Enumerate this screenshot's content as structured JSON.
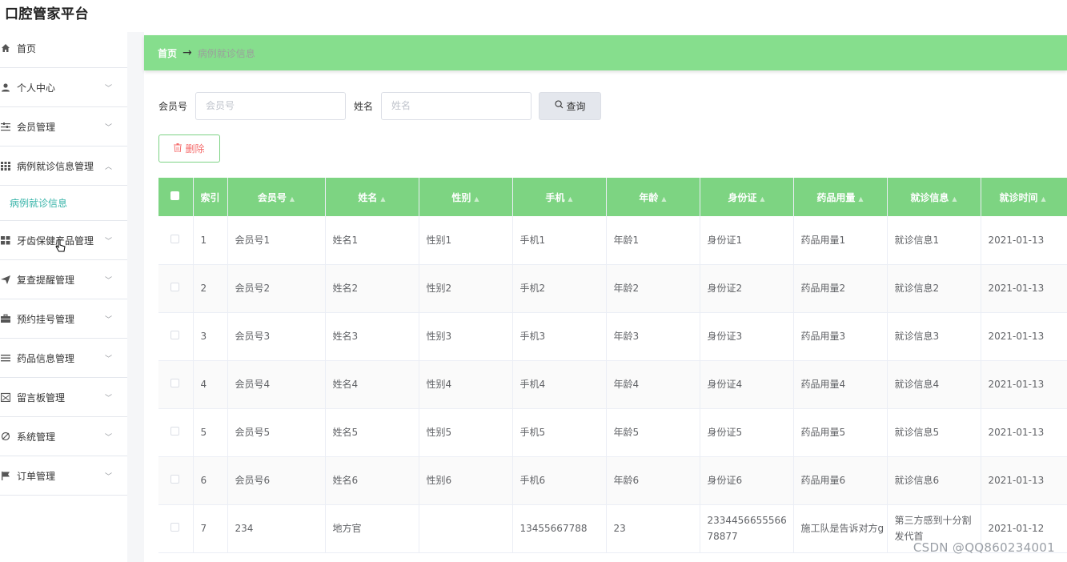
{
  "app": {
    "title": "口腔管家平台"
  },
  "sidebar": {
    "items": [
      {
        "label": "首页",
        "icon": "home-icon",
        "arrow": ""
      },
      {
        "label": "个人中心",
        "icon": "user-icon",
        "arrow": "﹀"
      },
      {
        "label": "会员管理",
        "icon": "sliders-icon",
        "arrow": "﹀"
      },
      {
        "label": "病例就诊信息管理",
        "icon": "grid-icon",
        "arrow": "︿"
      },
      {
        "label": "牙齿保健产品管理",
        "icon": "apps-icon",
        "arrow": "﹀"
      },
      {
        "label": "复查提醒管理",
        "icon": "send-icon",
        "arrow": "﹀"
      },
      {
        "label": "预约挂号管理",
        "icon": "briefcase-icon",
        "arrow": "﹀"
      },
      {
        "label": "药品信息管理",
        "icon": "list-icon",
        "arrow": "﹀"
      },
      {
        "label": "留言板管理",
        "icon": "message-icon",
        "arrow": "﹀"
      },
      {
        "label": "系统管理",
        "icon": "tools-icon",
        "arrow": "﹀"
      },
      {
        "label": "订单管理",
        "icon": "flag-icon",
        "arrow": "﹀"
      }
    ],
    "sub_item": "病例就诊信息"
  },
  "breadcrumb": {
    "home": "首页",
    "separator": "→",
    "current": "病例就诊信息"
  },
  "search": {
    "member_label": "会员号",
    "member_placeholder": "会员号",
    "name_label": "姓名",
    "name_placeholder": "姓名",
    "query_label": "查询"
  },
  "actions": {
    "delete_label": "删除"
  },
  "table": {
    "headers": [
      "索引",
      "会员号",
      "姓名",
      "性别",
      "手机",
      "年龄",
      "身份证",
      "药品用量",
      "就诊信息",
      "就诊时间"
    ],
    "rows": [
      [
        "1",
        "会员号1",
        "姓名1",
        "性别1",
        "手机1",
        "年龄1",
        "身份证1",
        "药品用量1",
        "就诊信息1",
        "2021-01-13"
      ],
      [
        "2",
        "会员号2",
        "姓名2",
        "性别2",
        "手机2",
        "年龄2",
        "身份证2",
        "药品用量2",
        "就诊信息2",
        "2021-01-13"
      ],
      [
        "3",
        "会员号3",
        "姓名3",
        "性别3",
        "手机3",
        "年龄3",
        "身份证3",
        "药品用量3",
        "就诊信息3",
        "2021-01-13"
      ],
      [
        "4",
        "会员号4",
        "姓名4",
        "性别4",
        "手机4",
        "年龄4",
        "身份证4",
        "药品用量4",
        "就诊信息4",
        "2021-01-13"
      ],
      [
        "5",
        "会员号5",
        "姓名5",
        "性别5",
        "手机5",
        "年龄5",
        "身份证5",
        "药品用量5",
        "就诊信息5",
        "2021-01-13"
      ],
      [
        "6",
        "会员号6",
        "姓名6",
        "性别6",
        "手机6",
        "年龄6",
        "身份证6",
        "药品用量6",
        "就诊信息6",
        "2021-01-13"
      ],
      [
        "7",
        "234",
        "地方官",
        "",
        "13455667788",
        "23",
        "233445665556678877",
        "施工队是告诉对方g",
        "第三方感到十分割发代首",
        "2021-01-12"
      ]
    ]
  },
  "watermark": "CSDN @QQ860234001",
  "colors": {
    "accent_green": "#86de8d",
    "delete_red": "#f56c6c",
    "sub_active": "#36b3a8"
  }
}
